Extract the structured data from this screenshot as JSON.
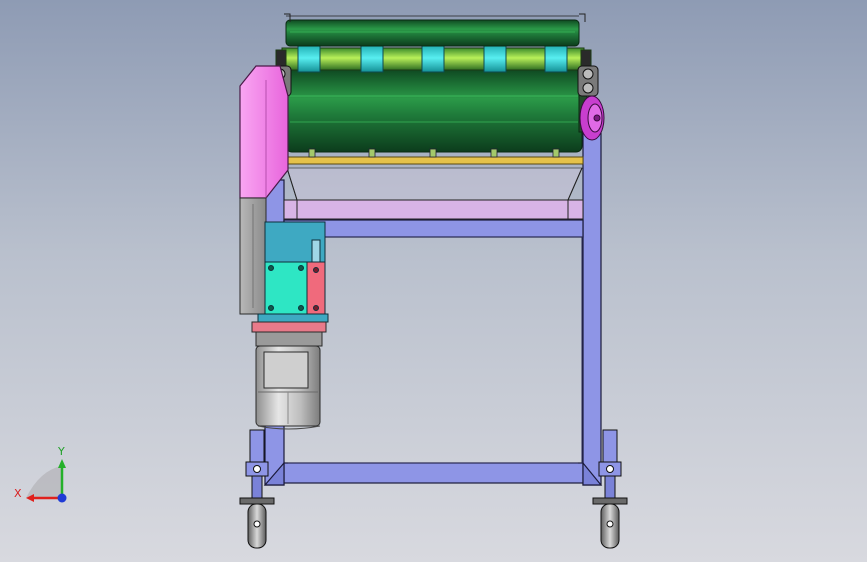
{
  "triad": {
    "x_label": "X",
    "y_label": "Y"
  },
  "colors": {
    "frame": "#8e95e6",
    "frame_dark": "#6d74c9",
    "roller_green": "#1f7a3a",
    "roller_light": "#2eaa50",
    "roller_hi": "#7fe07a",
    "collar_cyan": "#3fd3d8",
    "side_plate_pink": "#f47ee8",
    "bracket_gray": "#9a9a9a",
    "gearbox_blue": "#3ea9c2",
    "gearbox_cyan": "#2ee6c4",
    "plate_red": "#f06a7c",
    "pulley_magenta": "#c83ecf",
    "tray_lavender": "#d8b4e6",
    "strip_yellow": "#e5c24a",
    "motor_silver": "#c8c8c8",
    "axis_x": "#e0201c",
    "axis_y": "#24b02a",
    "axis_z": "#1f3bd6"
  }
}
